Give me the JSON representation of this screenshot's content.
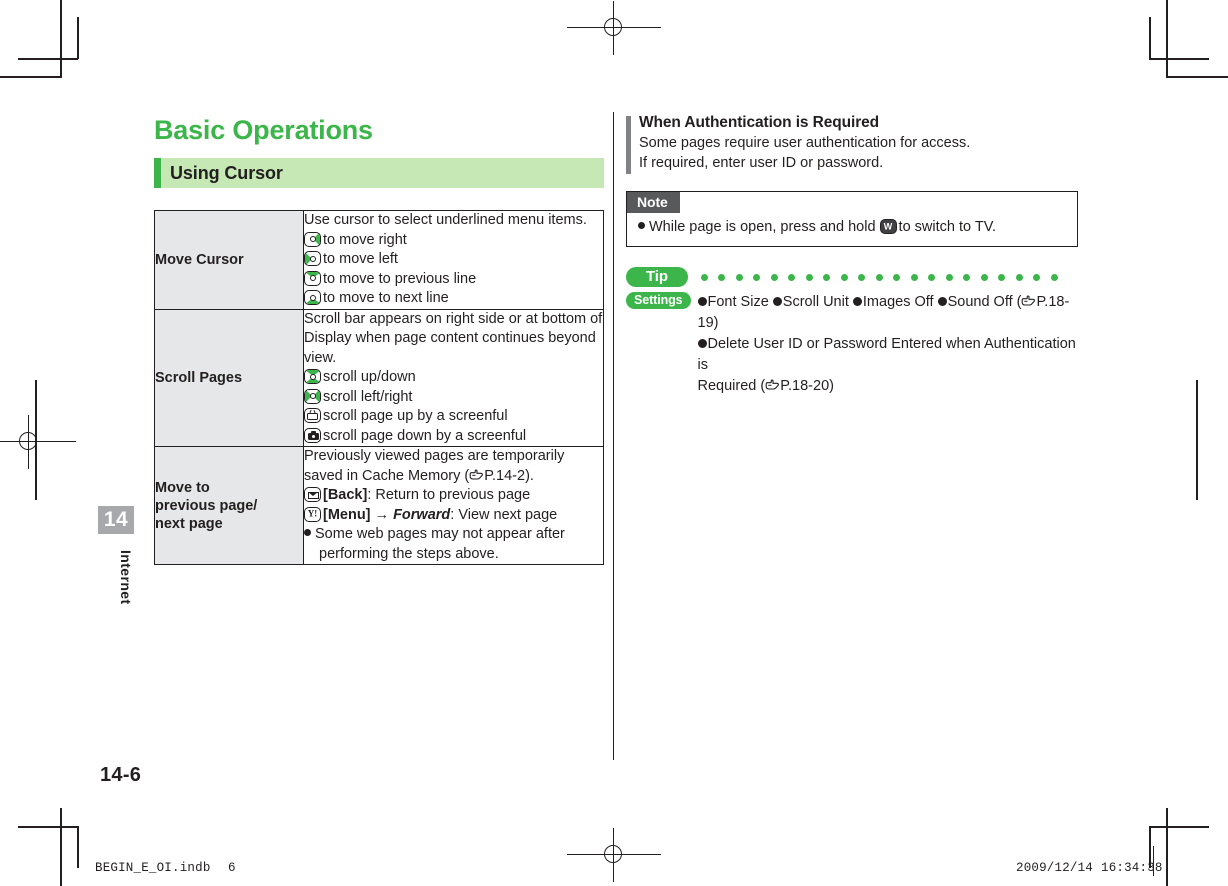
{
  "document": {
    "chapter_number": "14",
    "chapter_name": "Internet",
    "folio": "14-6",
    "chapter_title": "Basic Operations",
    "section_title": "Using Cursor"
  },
  "table": {
    "rows": [
      {
        "label": "Move Cursor",
        "intro": "Use cursor to select underlined menu items.",
        "items": [
          {
            "icon": "nav-key-right-icon",
            "text": "to move right"
          },
          {
            "icon": "nav-key-left-icon",
            "text": "to move left"
          },
          {
            "icon": "nav-key-up-icon",
            "text": "to move to previous line"
          },
          {
            "icon": "nav-key-down-icon",
            "text": "to move to next line"
          }
        ]
      },
      {
        "label": "Scroll Pages",
        "intro": "Scroll bar appears on right side or at bottom of Display when page content continues beyond view.",
        "items": [
          {
            "icon": "nav-key-updown-icon",
            "text": "scroll up/down"
          },
          {
            "icon": "nav-key-leftright-icon",
            "text": "scroll left/right"
          },
          {
            "icon": "tv-key-icon",
            "text": "scroll page up by a screenful"
          },
          {
            "icon": "camera-key-icon",
            "text": "scroll page down by a screenful"
          }
        ]
      },
      {
        "label": "Move to previous page/ next page",
        "intro_a": "Previously viewed pages are temporarily saved in Cache Memory (",
        "intro_ref": "P.14-2",
        "intro_b": ").",
        "back_key_label": "[Back]",
        "back_key_desc": ": Return to previous page",
        "menu_key_label": "[Menu]",
        "menu_arrow": "→",
        "menu_forward": "Forward",
        "menu_key_desc": ": View next page",
        "note_line1": "Some web pages may not appear after",
        "note_line2": "performing the steps above."
      }
    ]
  },
  "right_column": {
    "callout": {
      "heading": "When Authentication is Required",
      "line1": "Some pages require user authentication for access.",
      "line2": "If required, enter user ID or password."
    },
    "note": {
      "tag": "Note",
      "text_before": "While page is open, press and hold",
      "key_glyph": "W",
      "text_after": "to switch to TV."
    },
    "tip": {
      "tag": "Tip",
      "dot_count": 21,
      "settings_tag": "Settings",
      "items_line1": [
        "Font Size",
        "Scroll Unit",
        "Images Off",
        "Sound Off"
      ],
      "ref1": "P.18-19",
      "items_line2_a": "Delete User ID or Password Entered when Authentication is",
      "items_line2_b": "Required (",
      "ref2": "P.18-20",
      "items_line2_c": ")"
    }
  },
  "slug": {
    "filename": "BEGIN_E_OI.indb",
    "sheet": "6",
    "date": "2009/12/14",
    "time": "16:34:38"
  },
  "colors": {
    "green_accent": "#3cb54a",
    "green_band": "#c5e8b4",
    "gray_cell": "#e6e7e8",
    "gray_tab": "#a6a8ab",
    "gray_bar": "#808285",
    "note_tag": "#58595b",
    "ink": "#231f20"
  }
}
